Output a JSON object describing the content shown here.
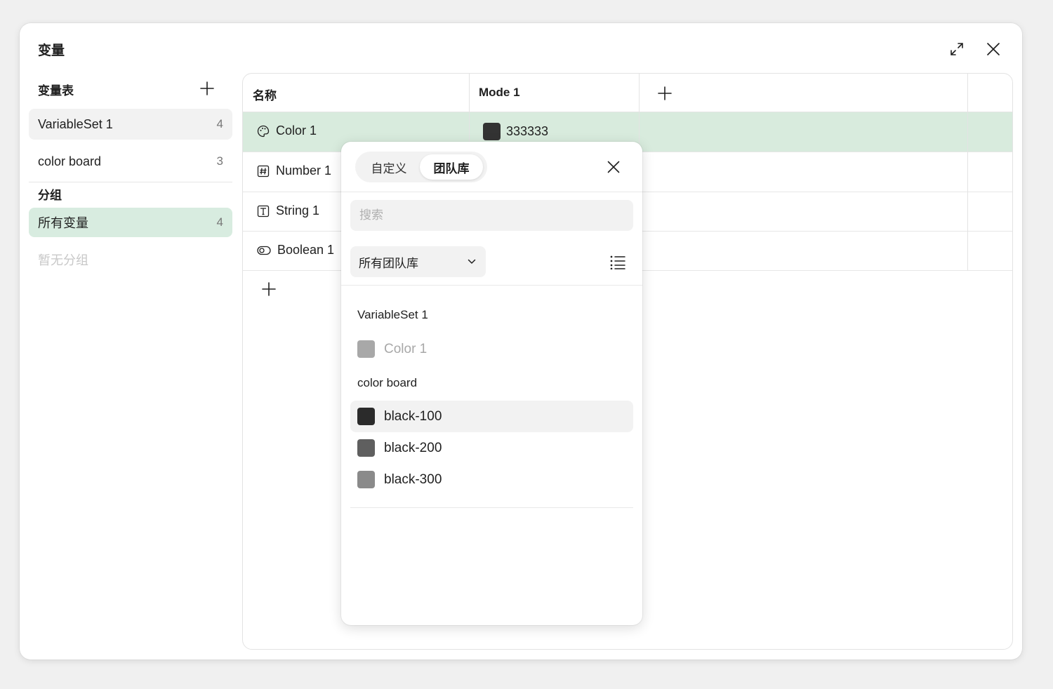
{
  "dialog": {
    "title": "变量"
  },
  "sidebar": {
    "sets_header": "变量表",
    "sets": [
      {
        "label": "VariableSet 1",
        "count": "4"
      },
      {
        "label": "color board",
        "count": "3"
      }
    ],
    "groups_header": "分组",
    "groups": [
      {
        "label": "所有变量",
        "count": "4"
      }
    ],
    "empty_groups": "暂无分组"
  },
  "table": {
    "headers": {
      "name": "名称",
      "mode": "Mode 1"
    },
    "rows": [
      {
        "name": "Color 1",
        "icon": "palette-icon",
        "value": "333333",
        "swatch": "#333333"
      },
      {
        "name": "Number 1",
        "icon": "number-icon"
      },
      {
        "name": "String 1",
        "icon": "text-icon"
      },
      {
        "name": "Boolean 1",
        "icon": "toggle-icon"
      }
    ]
  },
  "popover": {
    "tabs": [
      {
        "label": "自定义",
        "active": false
      },
      {
        "label": "团队库",
        "active": true
      }
    ],
    "search": {
      "placeholder": "搜索",
      "value": ""
    },
    "library_select": "所有团队库",
    "groups": [
      {
        "label": "VariableSet 1",
        "items": [
          {
            "name": "Color 1",
            "color": "#a8a8a8",
            "disabled": true
          }
        ]
      },
      {
        "label": "color board",
        "items": [
          {
            "name": "black-100",
            "color": "#2b2b2b"
          },
          {
            "name": "black-200",
            "color": "#5f5f5f"
          },
          {
            "name": "black-300",
            "color": "#8a8a8a"
          }
        ]
      }
    ]
  },
  "colors": {
    "selected_row": "#d8ebdd",
    "selected_group": "#d8ece0"
  }
}
